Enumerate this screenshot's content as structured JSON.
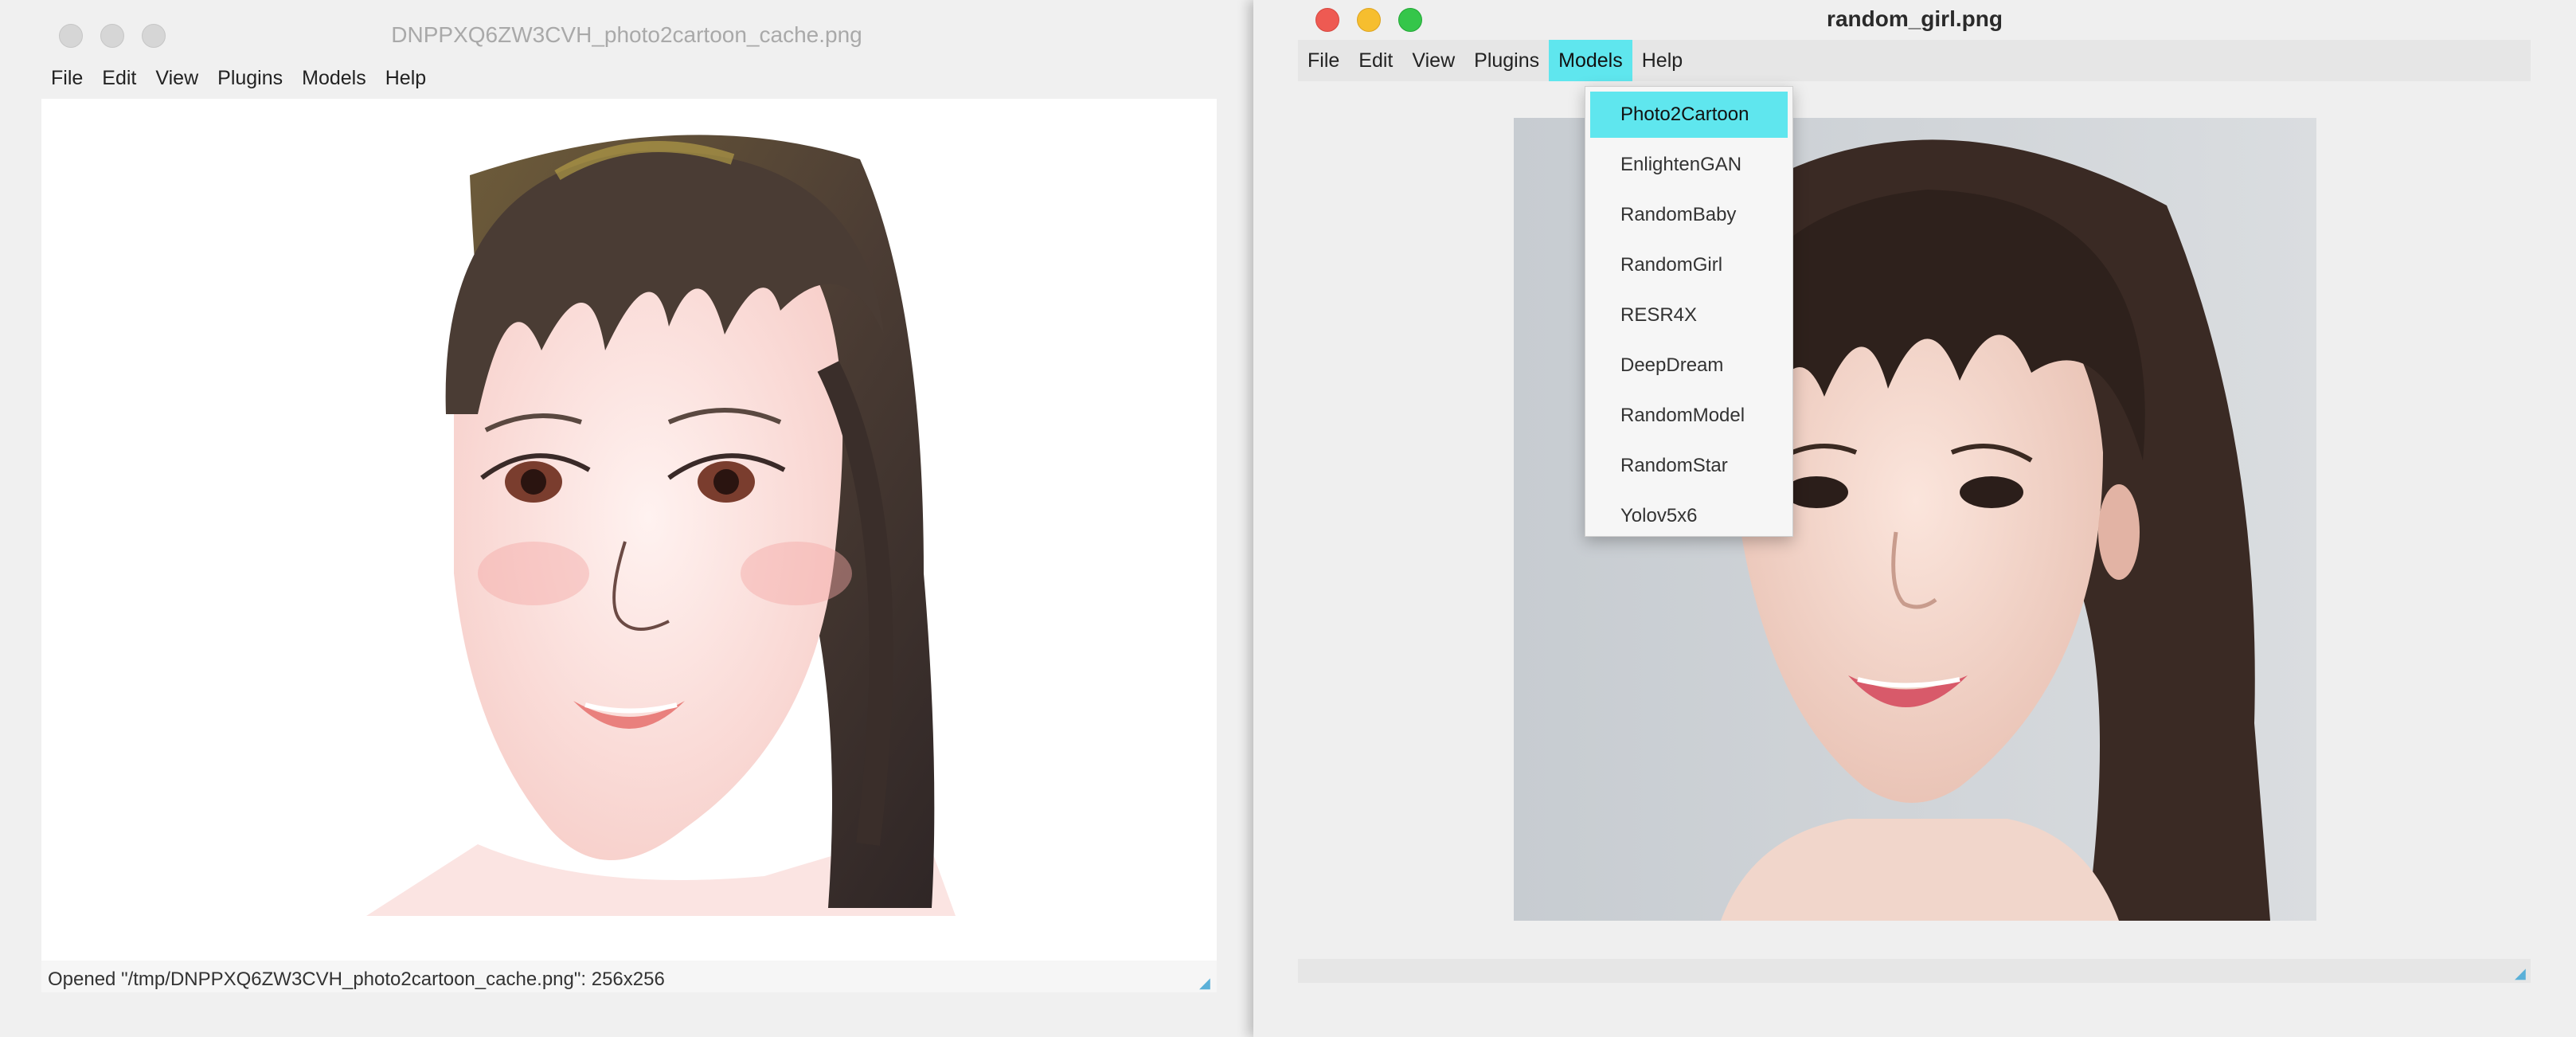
{
  "left_window": {
    "title": "DNPPXQ6ZW3CVH_photo2cartoon_cache.png",
    "menu": [
      "File",
      "Edit",
      "View",
      "Plugins",
      "Models",
      "Help"
    ],
    "status_text": "Opened \"/tmp/DNPPXQ6ZW3CVH_photo2cartoon_cache.png\": 256x256",
    "image_description": "cartoon-portrait"
  },
  "right_window": {
    "title": "random_girl.png",
    "menu": [
      "File",
      "Edit",
      "View",
      "Plugins",
      "Models",
      "Help"
    ],
    "active_menu": "Models",
    "models_dropdown": {
      "items": [
        "Photo2Cartoon",
        "EnlightenGAN",
        "RandomBaby",
        "RandomGirl",
        "RESR4X",
        "DeepDream",
        "RandomModel",
        "RandomStar",
        "Yolov5x6"
      ],
      "highlighted": "Photo2Cartoon"
    },
    "image_description": "photo-portrait"
  },
  "colors": {
    "traffic_close": "#ee5a52",
    "traffic_minimize": "#f6be2f",
    "traffic_zoom": "#35c64a",
    "menu_highlight": "#5fe6ee"
  },
  "icons": {
    "close": "close-icon",
    "minimize": "minimize-icon",
    "zoom": "zoom-icon",
    "resize": "resize-grip-icon"
  }
}
